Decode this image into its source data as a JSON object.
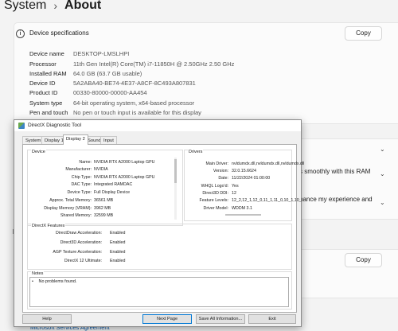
{
  "breadcrumb": {
    "parent": "System",
    "separator": "›",
    "current": "About"
  },
  "device_specs": {
    "title": "Device specifications",
    "copy_label": "Copy",
    "rows": [
      {
        "label": "Device name",
        "value": "DESKTOP-LMSLHPI"
      },
      {
        "label": "Processor",
        "value": "11th Gen Intel(R) Core(TM) i7-11850H @ 2.50GHz   2.50 GHz"
      },
      {
        "label": "Installed RAM",
        "value": "64.0 GB (63.7 GB usable)"
      },
      {
        "label": "Device ID",
        "value": "5A2ABA40-BE74-4E37-A8CF-8C493A807831"
      },
      {
        "label": "Product ID",
        "value": "00330-80000-00000-AA454"
      },
      {
        "label": "System type",
        "value": "64-bit operating system, x64-based processor"
      },
      {
        "label": "Pen and touch",
        "value": "No pen or touch input is available for this display"
      }
    ]
  },
  "partial_texts": {
    "ram_tip": "s smoothly with this RAM",
    "experience_tip": "hance my experience and",
    "related_heading": "R",
    "windows_copy_label": "Copy",
    "msa_link": "Microsoft Services Agreement"
  },
  "dxdiag": {
    "title": "DirectX Diagnostic Tool",
    "tabs": [
      "System",
      "Display 1",
      "Display 2",
      "Sound",
      "Input"
    ],
    "active_tab": "Display 2",
    "device": {
      "title": "Device",
      "rows": [
        {
          "label": "Name:",
          "value": "NVIDIA RTX A2000 Laptop GPU"
        },
        {
          "label": "Manufacturer:",
          "value": "NVIDIA"
        },
        {
          "label": "Chip Type:",
          "value": "NVIDIA RTX A2000 Laptop GPU"
        },
        {
          "label": "DAC Type:",
          "value": "Integrated RAMDAC"
        },
        {
          "label": "Device Type:",
          "value": "Full Display Device"
        },
        {
          "label": "Approx. Total Memory:",
          "value": "36561 MB"
        },
        {
          "label": "Display Memory (VRAM):",
          "value": "3962 MB"
        },
        {
          "label": "Shared Memory:",
          "value": "32599 MB"
        }
      ]
    },
    "drivers": {
      "title": "Drivers",
      "rows": [
        {
          "label": "Main Driver:",
          "value": "nvldumdx.dll,nvldumdx.dll,nvldumdx.dll"
        },
        {
          "label": "Version:",
          "value": "32.0.15.6624"
        },
        {
          "label": "Date:",
          "value": "11/22/2024 01:00:00"
        },
        {
          "label": "WHQL Logo'd:",
          "value": "Yes"
        },
        {
          "label": "Direct3D DDI:",
          "value": "12"
        },
        {
          "label": "Feature Levels:",
          "value": "12_2,12_1,12_0,11_1,11_0,10_1,10_"
        },
        {
          "label": "Driver Model:",
          "value": "WDDM 3.1"
        }
      ]
    },
    "features": {
      "title": "DirectX Features",
      "rows": [
        {
          "label": "DirectDraw Acceleration:",
          "value": "Enabled"
        },
        {
          "label": "Direct3D Acceleration:",
          "value": "Enabled"
        },
        {
          "label": "AGP Texture Acceleration:",
          "value": "Enabled"
        },
        {
          "label": "DirectX 12 Ultimate:",
          "value": "Enabled"
        }
      ]
    },
    "notes": {
      "title": "Notes",
      "items": [
        "No problems found."
      ]
    },
    "buttons": {
      "help": "Help",
      "next_page": "Next Page",
      "save_all": "Save All Information...",
      "exit": "Exit"
    }
  }
}
